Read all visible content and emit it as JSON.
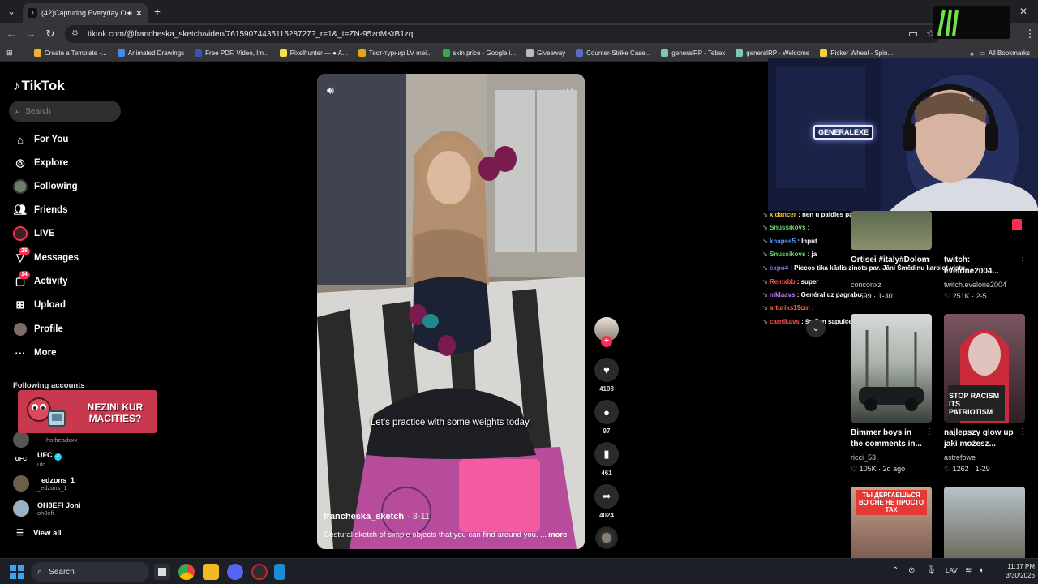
{
  "browser": {
    "tab_title": "(42)Capturing Everyday Obj",
    "new_tab": "+",
    "url": "tiktok.com/@francheska_sketch/video/7615907443511528727?_r=1&_t=ZN-95zoMKtB1zq",
    "bookmarks": [
      {
        "label": "Create a Template -...",
        "color": "#f2b134"
      },
      {
        "label": "Animated Drawings",
        "color": "#4a86e8"
      },
      {
        "label": "Free PDF, Video, Im...",
        "color": "#3f51b5"
      },
      {
        "label": "Pixelhunter — ● A...",
        "color": "#f7e04b"
      },
      {
        "label": "Тест-турнир LV mei...",
        "color": "#e8a317"
      },
      {
        "label": "skin price - Google i...",
        "color": "#34a853"
      },
      {
        "label": "Giveaway",
        "color": "#bbbbbb"
      },
      {
        "label": "Counter-Strike Case...",
        "color": "#5c6bc0"
      },
      {
        "label": "generalRP - Tebex",
        "color": "#7cc7b8"
      },
      {
        "label": "generalRP - Welcome",
        "color": "#7cc7b8"
      },
      {
        "label": "Picker Wheel - Spin...",
        "color": "#f4d03f"
      }
    ],
    "all_bookmarks": "All Bookmarks"
  },
  "sidebar": {
    "logo": "TikTok",
    "search_placeholder": "Search",
    "nav": [
      {
        "label": "For You",
        "icon": "home-icon"
      },
      {
        "label": "Explore",
        "icon": "compass-icon"
      },
      {
        "label": "Following",
        "icon": "following-avatar-icon"
      },
      {
        "label": "Friends",
        "icon": "friends-icon"
      },
      {
        "label": "LIVE",
        "icon": "live-icon"
      },
      {
        "label": "Messages",
        "icon": "messages-icon",
        "badge": "28"
      },
      {
        "label": "Activity",
        "icon": "activity-icon",
        "badge": "14"
      },
      {
        "label": "Upload",
        "icon": "upload-icon"
      },
      {
        "label": "Profile",
        "icon": "profile-avatar-icon"
      },
      {
        "label": "More",
        "icon": "more-icon"
      }
    ],
    "following_header": "Following accounts",
    "accounts": [
      {
        "name": "",
        "handle": "hotheadxxx"
      },
      {
        "name": "UFC",
        "handle": "ufc",
        "verified": true
      },
      {
        "name": "_edzons_1",
        "handle": "_edzons_1"
      },
      {
        "name": "OH8EFI Joni",
        "handle": "oh8efi"
      }
    ],
    "view_all": "View all",
    "ad_text": "NEZINI KUR MĀCĪTIES?"
  },
  "video": {
    "caption": "Let's practice with some weights today.",
    "author": "francheska_sketch",
    "date": "· 3-11",
    "description": "Gestural sketch of simple objects that you can find around you. ...",
    "more": "more",
    "likes": "4198",
    "comments": "97",
    "saves": "461",
    "shares": "4024"
  },
  "stream": {
    "sign": "GENERALEXE",
    "chat": [
      {
        "user": "xldancer",
        "msg": "nen u paldies par info",
        "color": "#f2c94c"
      },
      {
        "user": "Snussikovs",
        "msg": "",
        "color": "#6fdc6f"
      },
      {
        "user": "knapss5",
        "msg": "Input",
        "color": "#5b9cff"
      },
      {
        "user": "Snussikovs",
        "msg": "ja",
        "color": "#6fdc6f"
      },
      {
        "user": "expo4",
        "msg": "Piecos tika kārlis zinots par. Jāni Šmēdinu karolot vistu",
        "color": "#9b6bff"
      },
      {
        "user": "Reinxbb",
        "msg": "super",
        "color": "#ff4d4d"
      },
      {
        "user": "niklaavs",
        "msg": "Genéral uz pagrabu",
        "color": "#c27cff"
      },
      {
        "user": "arturiks19cm",
        "msg": "",
        "color": "#ff6a3d"
      },
      {
        "user": "carnikavs",
        "msg": "šodien sapulce bija?",
        "color": "#ff4d4d"
      }
    ]
  },
  "grid": [
    {
      "title": "Ortisei #italy#Dolomit#...",
      "user": "conconxz",
      "stats": "♡ 599 · 1-30"
    },
    {
      "title": "twitch: evelone2004...",
      "user": "twitch.evelone2004",
      "stats": "♡ 251K · 2-5"
    },
    {
      "title": "Bimmer boys in the comments in...",
      "user": "ricci_53",
      "stats": "♡ 105K · 2d ago"
    },
    {
      "title": "najlepszy glow up jaki możesz...",
      "user": "astrefowe",
      "stats": "♡ 1262 · 1-29"
    },
    {
      "thumb_text": "ТЫ ДЁРГАЕШЬСЯ ВО СНЕ НЕ ПРОСТО ТАК"
    },
    {}
  ],
  "thumb_texts": {
    "patriotism": "STOP RACISM ITS PATRIOTISM"
  },
  "taskbar": {
    "search": "Search",
    "lang": "LAV",
    "time": "11:17 PM",
    "date": "3/30/2026"
  }
}
